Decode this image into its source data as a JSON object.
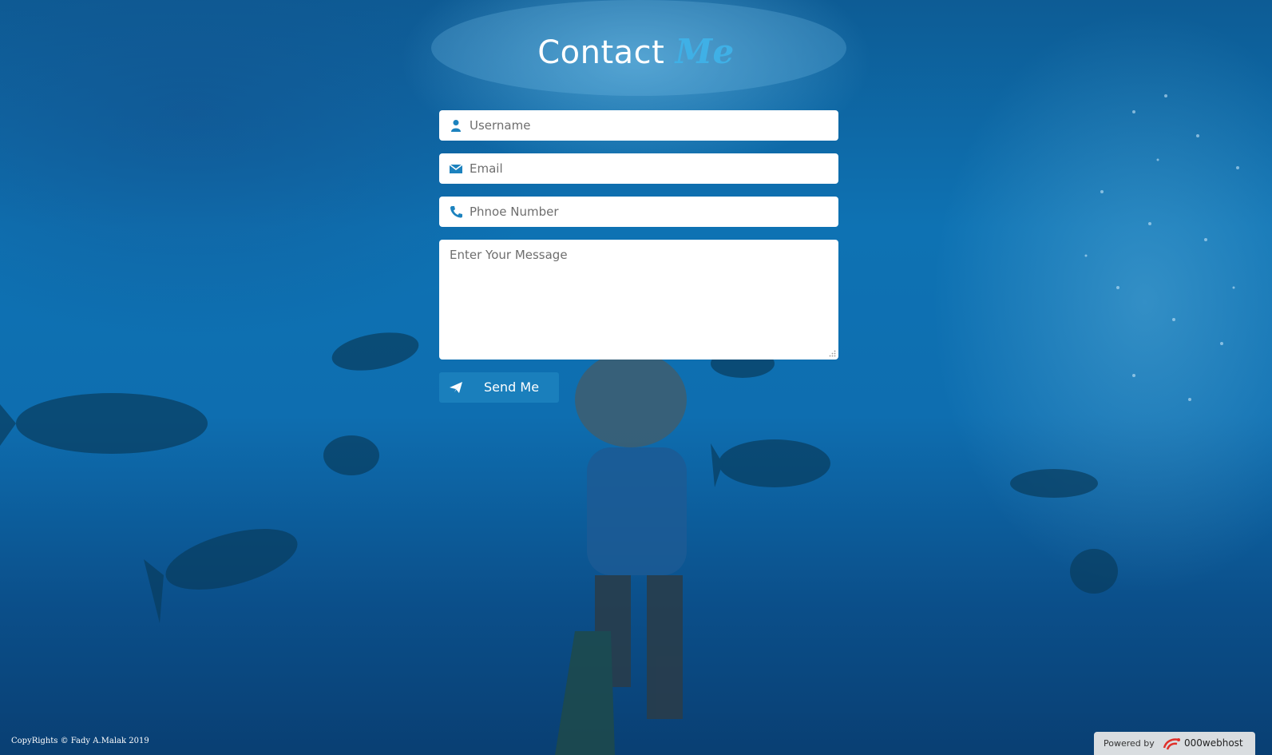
{
  "header": {
    "title_main": "Contact",
    "title_accent": "Me"
  },
  "form": {
    "username": {
      "placeholder": "Username",
      "icon": "user-icon"
    },
    "email": {
      "placeholder": "Email",
      "icon": "envelope-icon"
    },
    "phone": {
      "placeholder": "Phnoe Number",
      "icon": "phone-icon"
    },
    "message": {
      "placeholder": "Enter Your Message"
    },
    "submit": {
      "label": "Send Me",
      "icon": "paper-plane-icon"
    }
  },
  "footer": {
    "copyright": "CopyRights © Fady A.Malak 2019",
    "powered_by": "Powered by",
    "host_brand": "000webhost"
  },
  "colors": {
    "accent": "#3fb0e6",
    "button": "#1c82be",
    "icon": "#1c82be"
  }
}
